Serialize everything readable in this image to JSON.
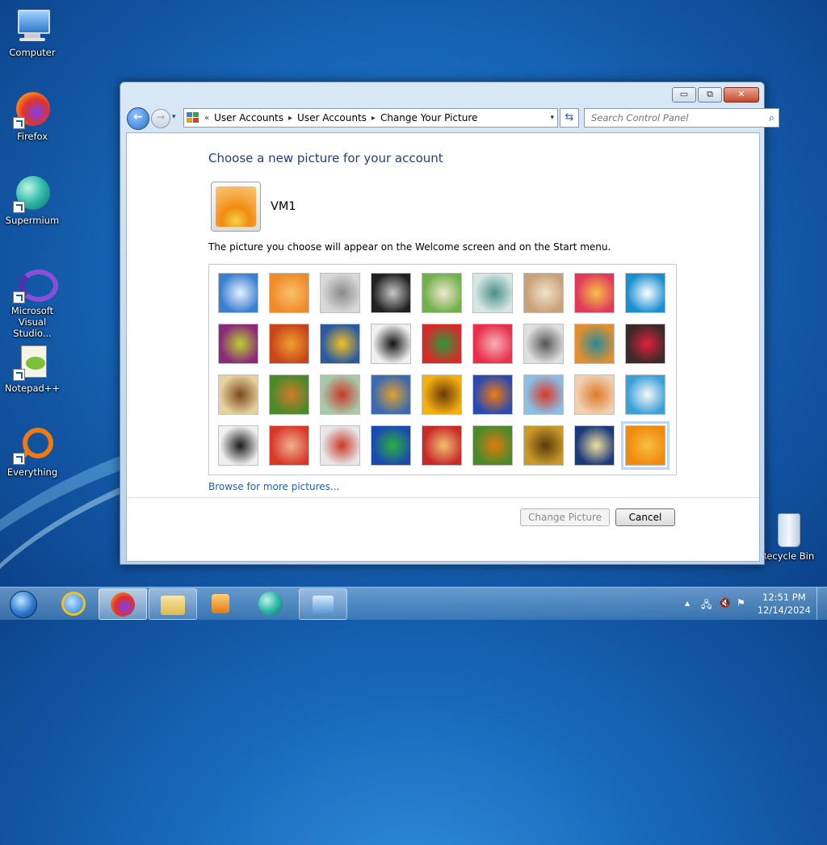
{
  "desktop": {
    "icons": [
      {
        "label": "Computer"
      },
      {
        "label": "Firefox"
      },
      {
        "label": "Supermium"
      },
      {
        "label": "Microsoft Visual Studio..."
      },
      {
        "label": "Notepad++"
      },
      {
        "label": "Everything"
      },
      {
        "label": "Recycle Bin"
      }
    ]
  },
  "window": {
    "caption_buttons": {
      "minimize": "▭",
      "maximize": "⧉",
      "close": "✕"
    },
    "nav": {
      "back": "←",
      "forward": "→",
      "history_dropdown": "▾"
    },
    "address": {
      "prefix": "«",
      "crumbs": [
        "User Accounts",
        "User Accounts",
        "Change Your Picture"
      ],
      "separator": "▸",
      "dropdown": "▾"
    },
    "refresh": "⇆",
    "search": {
      "placeholder": "Search Control Panel",
      "icon": "⌕"
    }
  },
  "page": {
    "title": "Choose a new picture for your account",
    "username": "VM1",
    "description": "The picture you choose will appear on the Welcome screen and on the Start menu.",
    "browse_link": "Browse for more pictures...",
    "change_picture_button": "Change Picture",
    "cancel_button": "Cancel",
    "pictures": [
      {
        "name": "roller-coaster",
        "colors": [
          "#3a7fd0",
          "#e8f2ff"
        ]
      },
      {
        "name": "starfish",
        "colors": [
          "#f08a2a",
          "#f7c26a"
        ]
      },
      {
        "name": "robot-toy",
        "colors": [
          "#d8d8d8",
          "#8a8a8a"
        ]
      },
      {
        "name": "turntable",
        "colors": [
          "#222222",
          "#c8c8c8"
        ]
      },
      {
        "name": "lucky-cat",
        "colors": [
          "#6fb14a",
          "#f0e6d0"
        ]
      },
      {
        "name": "gyroscope",
        "colors": [
          "#d6e7e4",
          "#4a8f8a"
        ]
      },
      {
        "name": "kitten",
        "colors": [
          "#c8a07a",
          "#f1e2c8"
        ]
      },
      {
        "name": "flower-pink",
        "colors": [
          "#e03a5a",
          "#f5c14a"
        ]
      },
      {
        "name": "pinwheel",
        "colors": [
          "#1a8fd0",
          "#ffffff"
        ]
      },
      {
        "name": "ball-purple",
        "colors": [
          "#8a2a7a",
          "#b8d030"
        ]
      },
      {
        "name": "fabric-stripes",
        "colors": [
          "#c8461a",
          "#f0a030"
        ]
      },
      {
        "name": "yellow-leaf",
        "colors": [
          "#2a5aa0",
          "#f5c020"
        ]
      },
      {
        "name": "border-collie",
        "colors": [
          "#f0f0f0",
          "#111111"
        ]
      },
      {
        "name": "crayons",
        "colors": [
          "#d82a2a",
          "#2a9a3a"
        ]
      },
      {
        "name": "red-star",
        "colors": [
          "#e8304a",
          "#f7b0b8"
        ]
      },
      {
        "name": "jacks",
        "colors": [
          "#e0e0e0",
          "#555555"
        ]
      },
      {
        "name": "stairs",
        "colors": [
          "#e09030",
          "#2a8a9a"
        ]
      },
      {
        "name": "paper-crane",
        "colors": [
          "#3a2a2a",
          "#e0203a"
        ]
      },
      {
        "name": "guitar",
        "colors": [
          "#e8d0a0",
          "#7a4a1a"
        ]
      },
      {
        "name": "pomeranian",
        "colors": [
          "#4a8a2a",
          "#d07a2a"
        ]
      },
      {
        "name": "tin-robot",
        "colors": [
          "#a8c8a8",
          "#c83a2a"
        ]
      },
      {
        "name": "scarves",
        "colors": [
          "#3a6ab0",
          "#e0a030"
        ]
      },
      {
        "name": "sunflower",
        "colors": [
          "#f5b010",
          "#6a3a0a"
        ]
      },
      {
        "name": "fish",
        "colors": [
          "#2a4ab0",
          "#f07a10"
        ]
      },
      {
        "name": "hot-air-balloon",
        "colors": [
          "#8ac0e8",
          "#d83a2a"
        ]
      },
      {
        "name": "doll",
        "colors": [
          "#f0d0b0",
          "#e07a2a"
        ]
      },
      {
        "name": "sailboat",
        "colors": [
          "#3aa0d8",
          "#f8f8f8"
        ]
      },
      {
        "name": "soccer-ball",
        "colors": [
          "#f0f0f0",
          "#1a1a1a"
        ]
      },
      {
        "name": "fabric-red",
        "colors": [
          "#d83a2a",
          "#f0b090"
        ]
      },
      {
        "name": "marbles",
        "colors": [
          "#e8e8e8",
          "#c83a2a"
        ]
      },
      {
        "name": "window",
        "colors": [
          "#1a4ab0",
          "#2ab040"
        ]
      },
      {
        "name": "rug",
        "colors": [
          "#c82a2a",
          "#f0c070"
        ]
      },
      {
        "name": "butterfly",
        "colors": [
          "#4a8a2a",
          "#e07a10"
        ]
      },
      {
        "name": "basket",
        "colors": [
          "#c89a2a",
          "#5a3a0a"
        ]
      },
      {
        "name": "lighthouse",
        "colors": [
          "#1a3a7a",
          "#f0e0a0"
        ]
      },
      {
        "name": "orange-flower",
        "colors": [
          "#f08a10",
          "#f5c040"
        ],
        "selected": true
      }
    ]
  },
  "taskbar": {
    "items": [
      {
        "name": "start-button"
      },
      {
        "name": "internet-explorer"
      },
      {
        "name": "firefox"
      },
      {
        "name": "file-explorer"
      },
      {
        "name": "media-player"
      },
      {
        "name": "supermium"
      },
      {
        "name": "control-panel"
      }
    ],
    "tray": {
      "show_hidden": "▴",
      "network": "🖧",
      "volume_muted": "🔇",
      "flag": "⚑"
    },
    "clock": {
      "time": "12:51 PM",
      "date": "12/14/2024"
    }
  }
}
